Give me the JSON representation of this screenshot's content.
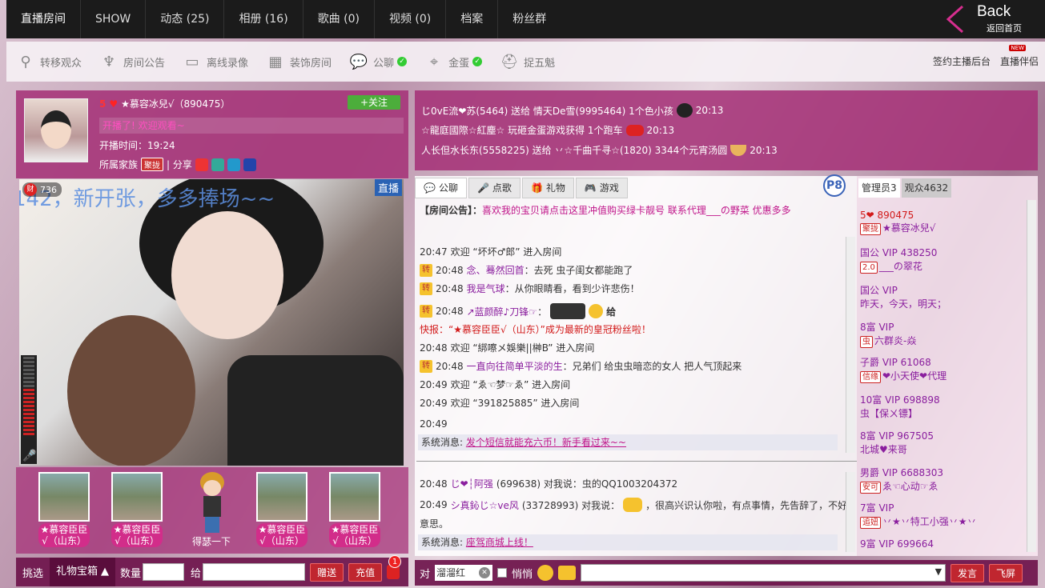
{
  "nav": {
    "tabs": [
      "直播房间",
      "SHOW",
      "动态 (25)",
      "相册 (16)",
      "歌曲 (0)",
      "视频 (0)",
      "档案",
      "粉丝群"
    ],
    "back_title": "Back",
    "back_sub": "返回首页"
  },
  "toolbar": {
    "items": [
      {
        "icon": "transfer-icon",
        "label": "转移观众"
      },
      {
        "icon": "tower-icon",
        "label": "房间公告"
      },
      {
        "icon": "monitor-icon",
        "label": "离线录像"
      },
      {
        "icon": "decor-icon",
        "label": "装饰房间"
      },
      {
        "icon": "chat-icon",
        "label": "公聊"
      },
      {
        "icon": "pin-icon",
        "label": "金蛋"
      },
      {
        "icon": "hat-icon",
        "label": "捉五魁"
      }
    ],
    "right": [
      "签约主播后台",
      "直播伴侣"
    ],
    "new_badge": "NEW"
  },
  "anchor": {
    "level": "5",
    "name": "★慕容冰兒√（890475）",
    "follow": "+关注",
    "welcome": "开播了! 欢迎观看~",
    "start_time": "开播时间：19:24",
    "family_label": "所属家族",
    "family_tag": "聚拢",
    "share": "| 分享"
  },
  "video": {
    "marquee": "142，新开张，多多捧场~~",
    "live_label": "直播",
    "viewers": "736",
    "cai": "财"
  },
  "guards": [
    {
      "name1": "★慕容臣臣",
      "name2": "√（山东）"
    },
    {
      "name1": "★慕容臣臣",
      "name2": "√（山东）"
    },
    {
      "empty": "得瑟一下"
    },
    {
      "name1": "★慕容臣臣",
      "name2": "√（山东）"
    },
    {
      "name1": "★慕容臣臣",
      "name2": "√（山东）"
    }
  ],
  "giftbar": {
    "pick": "挑选",
    "tab": "礼物宝箱",
    "qty": "数量",
    "give": "给",
    "send": "赠送",
    "recharge": "充值",
    "count": "1"
  },
  "ticker": [
    "じ0vΕ流❤苏(5464) 送给 情天De雪(9995464) 1个色小孩",
    "☆龍庭國際☆紅塵☆ 玩砸金蛋游戏获得 1个跑车",
    "人长但水长东(5558225) 送给 丷☆千曲千寻☆(1820) 3344个元宵汤圆"
  ],
  "ticker_times": [
    "20:13",
    "20:13",
    "20:13"
  ],
  "chat_tabs": [
    "公聊",
    "点歌",
    "礼物",
    "游戏"
  ],
  "p8": "P8",
  "notice_label": "【房间公告】：",
  "notice_text": "喜欢我的宝贝请点击这里冲值购买绿卡靓号 联系代理___の野菜 优惠多多",
  "messages": [
    {
      "time": "20:47",
      "text": "欢迎 “坏坏♂郎” 进入房间"
    },
    {
      "time": "20:48",
      "zhuan": "转",
      "user": "念、蓦然回首",
      "text": "：去死 虫子闺女都能跑了"
    },
    {
      "time": "20:48",
      "zhuan": "转",
      "user": "我是气球",
      "text": "：从你眼睛看，看到少许悲伤！"
    },
    {
      "time": "20:48",
      "zhuan": "转",
      "user": "↗蓝颜醉♪刀锋☞",
      "text": "：",
      "gift": "给"
    },
    {
      "express": "快报：“★慕容臣臣√（山东）”成为最新的皇冠粉丝啦！"
    },
    {
      "time": "20:48",
      "text": "欢迎 “綁嚓メ娛樂||榊B” 进入房间"
    },
    {
      "time": "20:48",
      "zhuan": "转",
      "user": "一直向往简单平淡的生",
      "text": "：兄弟们 给虫虫暗恋的女人 把人气顶起来"
    },
    {
      "time": "20:49",
      "text": "欢迎 “ゑ☜梦☞ゑ” 进入房间"
    },
    {
      "time": "20:49",
      "text": "欢迎 “391825885” 进入房间"
    },
    {
      "time": "20:49",
      "text": ""
    }
  ],
  "sys1_label": "系统消息:",
  "sys1_link": "发个短信就能充六币！新手看过来~~",
  "private": [
    {
      "time": "20:48",
      "user": "じ❤┆阿强",
      "text": "(699638) 对我说：虫的QQ1003204372"
    },
    {
      "time": "20:49",
      "user": "シ真鈊じ☆ve风",
      "text": "(33728993) 对我说：",
      "tail": "，很高兴识认你啦，有点事情，先告辞了，不好",
      "line2": "意思。"
    }
  ],
  "sys2_label": "系统消息:",
  "sys2_link": "座驾商城上线！",
  "user_tabs": [
    "管理员3",
    "观众4632"
  ],
  "users": [
    {
      "line1": "5❤ 890475",
      "tag": "聚拢",
      "name": "★慕容冰兒√"
    },
    {
      "line1": "国公 VIP 438250",
      "tag": "2.0",
      "name": "___の翠花"
    },
    {
      "line1": "国公 VIP",
      "name": "昨天，今天，明天；"
    },
    {
      "line1": "8富 VIP",
      "tag": "虫",
      "name": "六群炎-焱"
    },
    {
      "line1": "子爵 VIP 61068",
      "tag": "信缘",
      "name": "❤小天使❤代理"
    },
    {
      "line1": "10富 VIP 698898",
      "name": "虫【保ㄨ镖】"
    },
    {
      "line1": "8富 VIP 967505",
      "name": "北城♥来哥"
    },
    {
      "line1": "男爵 VIP 6688303",
      "tag": "安可",
      "name": "ゑ☜心动☞ゑ"
    },
    {
      "line1": "7富 VIP",
      "tag": "追妞",
      "name": "丷★丷特工小强丷★丷"
    },
    {
      "line1": "9富 VIP 699664",
      "name": ""
    }
  ],
  "input": {
    "to_label": "对",
    "to_value": "溜溜红",
    "whisper": "悄悄",
    "send": "发言",
    "fly": "飞屏"
  }
}
